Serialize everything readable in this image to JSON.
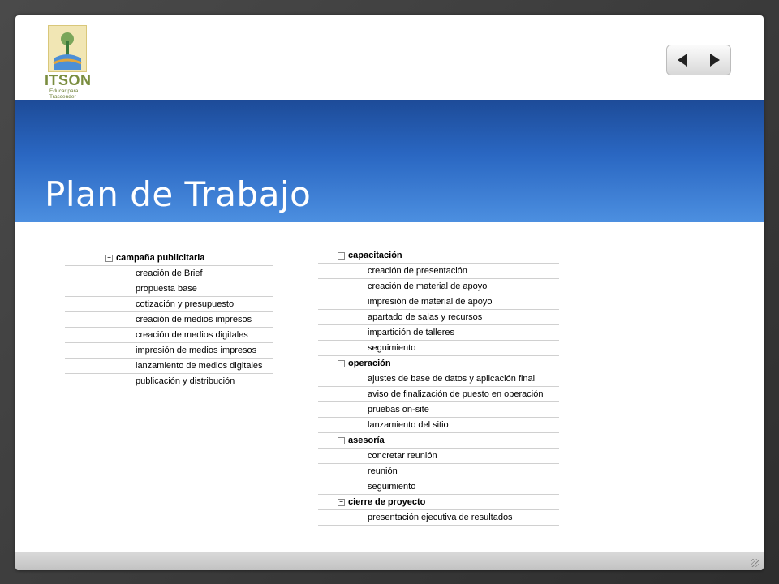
{
  "logo": {
    "brand": "ITSON",
    "tagline": "Educar para Trascender"
  },
  "slide": {
    "title": "Plan de Trabajo"
  },
  "navigation": {
    "prev_icon": "triangle-left-icon",
    "next_icon": "triangle-right-icon"
  },
  "tree_left": {
    "groups": [
      {
        "label": "campaña publicitaria",
        "items": [
          "creación de Brief",
          "propuesta base",
          "cotización y presupuesto",
          "creación de medios impresos",
          "creación de medios digitales",
          "impresión de medios impresos",
          "lanzamiento de medios digitales",
          "publicación y distribución"
        ]
      }
    ]
  },
  "tree_right": {
    "groups": [
      {
        "label": "capacitación",
        "items": [
          "creación de presentación",
          "creación de material de apoyo",
          "impresión de material de apoyo",
          "apartado de salas y recursos",
          "impartición de talleres",
          "seguimiento"
        ]
      },
      {
        "label": "operación",
        "items": [
          "ajustes de base de datos y aplicación final",
          "aviso de finalización de puesto en operación",
          "pruebas on-site",
          "lanzamiento del sitio"
        ]
      },
      {
        "label": "asesoría",
        "items": [
          "concretar reunión",
          "reunión",
          "seguimiento"
        ]
      },
      {
        "label": "cierre de proyecto",
        "items": [
          "presentación ejecutiva de resultados"
        ]
      }
    ]
  }
}
